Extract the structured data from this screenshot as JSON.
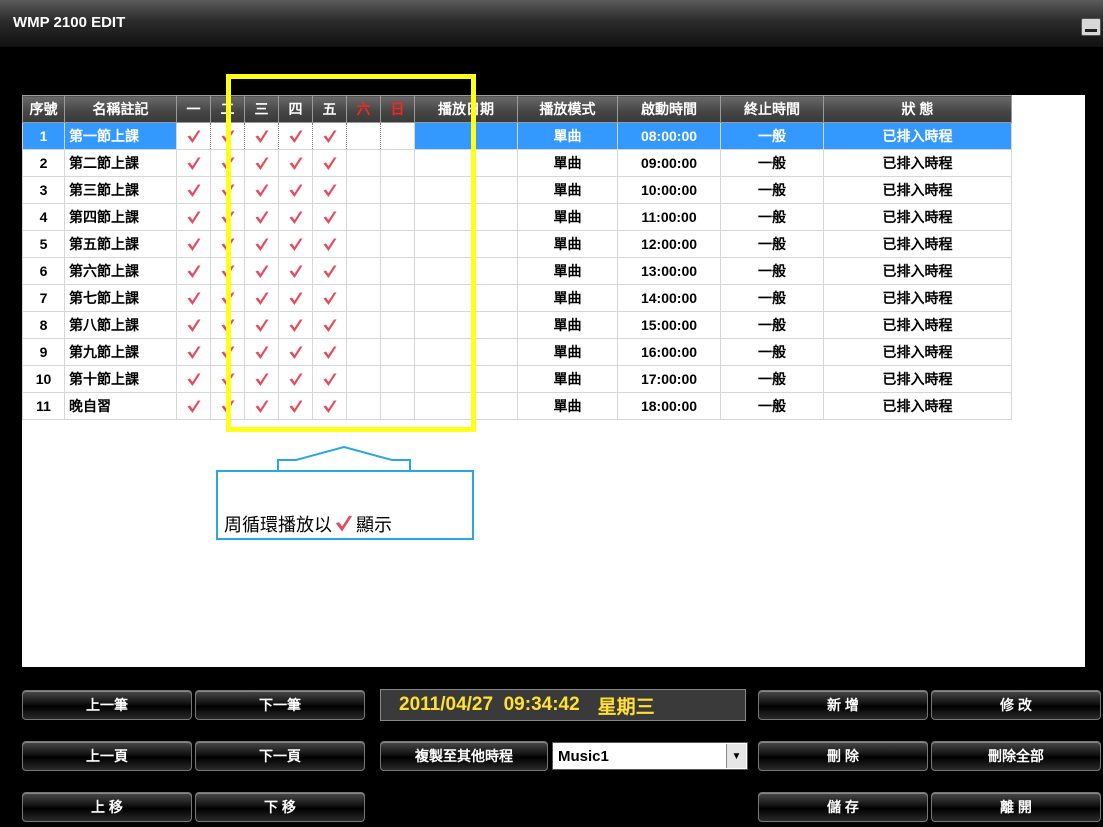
{
  "window": {
    "title": "WMP 2100 EDIT"
  },
  "table": {
    "headers": [
      "序號",
      "名稱註記",
      "一",
      "二",
      "三",
      "四",
      "五",
      "六",
      "日",
      "播放日期",
      "播放模式",
      "啟動時間",
      "終止時間",
      "狀 態"
    ],
    "rows": [
      {
        "no": "1",
        "name": "第一節上課",
        "days": [
          true,
          true,
          true,
          true,
          true,
          false,
          false
        ],
        "date": "",
        "mode": "單曲",
        "start": "08:00:00",
        "end": "一般",
        "status": "已排入時程"
      },
      {
        "no": "2",
        "name": "第二節上課",
        "days": [
          true,
          true,
          true,
          true,
          true,
          false,
          false
        ],
        "date": "",
        "mode": "單曲",
        "start": "09:00:00",
        "end": "一般",
        "status": "已排入時程"
      },
      {
        "no": "3",
        "name": "第三節上課",
        "days": [
          true,
          true,
          true,
          true,
          true,
          false,
          false
        ],
        "date": "",
        "mode": "單曲",
        "start": "10:00:00",
        "end": "一般",
        "status": "已排入時程"
      },
      {
        "no": "4",
        "name": "第四節上課",
        "days": [
          true,
          true,
          true,
          true,
          true,
          false,
          false
        ],
        "date": "",
        "mode": "單曲",
        "start": "11:00:00",
        "end": "一般",
        "status": "已排入時程"
      },
      {
        "no": "5",
        "name": "第五節上課",
        "days": [
          true,
          true,
          true,
          true,
          true,
          false,
          false
        ],
        "date": "",
        "mode": "單曲",
        "start": "12:00:00",
        "end": "一般",
        "status": "已排入時程"
      },
      {
        "no": "6",
        "name": "第六節上課",
        "days": [
          true,
          true,
          true,
          true,
          true,
          false,
          false
        ],
        "date": "",
        "mode": "單曲",
        "start": "13:00:00",
        "end": "一般",
        "status": "已排入時程"
      },
      {
        "no": "7",
        "name": "第七節上課",
        "days": [
          true,
          true,
          true,
          true,
          true,
          false,
          false
        ],
        "date": "",
        "mode": "單曲",
        "start": "14:00:00",
        "end": "一般",
        "status": "已排入時程"
      },
      {
        "no": "8",
        "name": "第八節上課",
        "days": [
          true,
          true,
          true,
          true,
          true,
          false,
          false
        ],
        "date": "",
        "mode": "單曲",
        "start": "15:00:00",
        "end": "一般",
        "status": "已排入時程"
      },
      {
        "no": "9",
        "name": "第九節上課",
        "days": [
          true,
          true,
          true,
          true,
          true,
          false,
          false
        ],
        "date": "",
        "mode": "單曲",
        "start": "16:00:00",
        "end": "一般",
        "status": "已排入時程"
      },
      {
        "no": "10",
        "name": "第十節上課",
        "days": [
          true,
          true,
          true,
          true,
          true,
          false,
          false
        ],
        "date": "",
        "mode": "單曲",
        "start": "17:00:00",
        "end": "一般",
        "status": "已排入時程"
      },
      {
        "no": "11",
        "name": "晚自習",
        "days": [
          true,
          true,
          true,
          true,
          true,
          false,
          false
        ],
        "date": "",
        "mode": "單曲",
        "start": "18:00:00",
        "end": "一般",
        "status": "已排入時程"
      }
    ],
    "selected_row": 0
  },
  "annotation": {
    "text_before": "周循環播放以",
    "text_after": "顯示",
    "icon": "check-icon"
  },
  "colors": {
    "highlight": "#ffff1a",
    "selection": "#3399ff",
    "date_text": "#ffe033",
    "callout": "#27a8e0",
    "weekend_header": "#ff2020"
  },
  "buttons": {
    "prev_record": "上一筆",
    "next_record": "下一筆",
    "prev_page": "上一頁",
    "next_page": "下一頁",
    "move_up": "上 移",
    "move_down": "下 移",
    "copy_to_other": "複製至其他時程",
    "add": "新 增",
    "edit": "修 改",
    "delete": "刪 除",
    "delete_all": "刪除全部",
    "save": "儲 存",
    "leave": "離 開"
  },
  "datetime": {
    "display": "2011/04/27  09:34:42",
    "weekday": "星期三"
  },
  "schedule_select": {
    "value": "Music1"
  }
}
